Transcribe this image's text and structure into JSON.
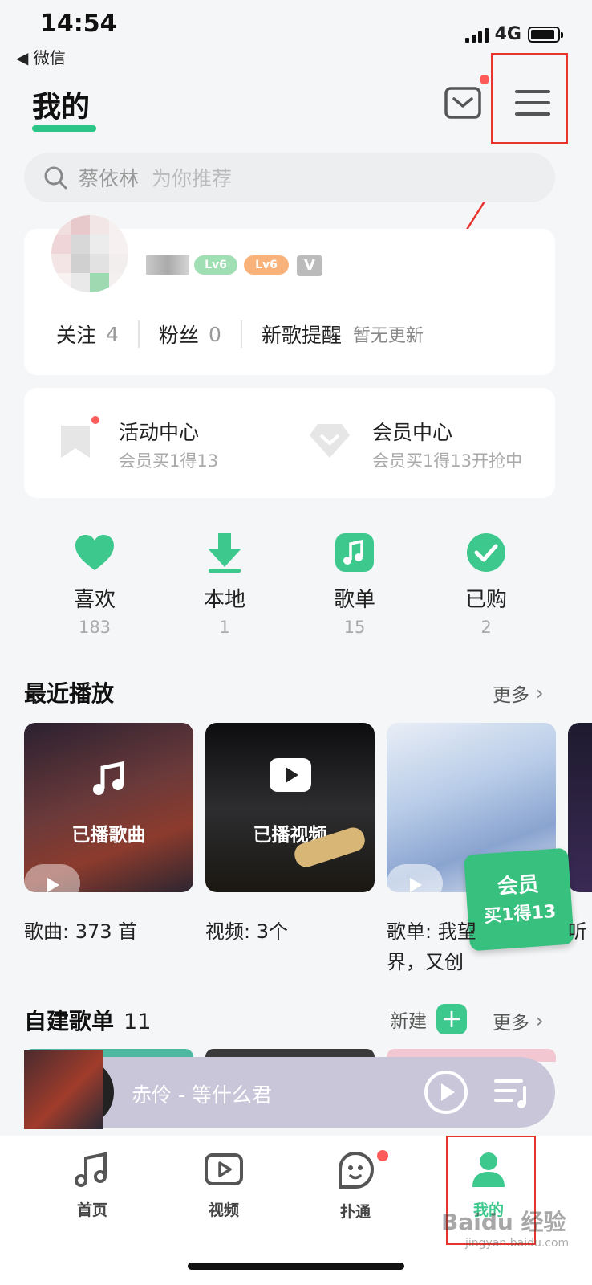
{
  "status_bar": {
    "time": "14:54",
    "back_app": "◀ 微信",
    "network": "4G"
  },
  "header": {
    "title": "我的"
  },
  "search": {
    "placeholder": "蔡依林",
    "hint": "为你推荐"
  },
  "profile": {
    "badges": [
      "Lv6",
      "Lv6",
      "V"
    ],
    "stats": [
      {
        "label": "关注",
        "value": "4"
      },
      {
        "label": "粉丝",
        "value": "0"
      }
    ],
    "new_song_label": "新歌提醒",
    "new_song_status": "暂无更新"
  },
  "activity": {
    "items": [
      {
        "title": "活动中心",
        "subtitle": "会员买1得13"
      },
      {
        "title": "会员中心",
        "subtitle": "会员买1得13开抢中"
      }
    ]
  },
  "quick_links": [
    {
      "label": "喜欢",
      "count": "183",
      "icon": "heart-icon"
    },
    {
      "label": "本地",
      "count": "1",
      "icon": "download-icon"
    },
    {
      "label": "歌单",
      "count": "15",
      "icon": "music-note-icon"
    },
    {
      "label": "已购",
      "count": "2",
      "icon": "check-icon"
    }
  ],
  "recent": {
    "title": "最近播放",
    "more": "更多",
    "tiles": [
      {
        "overlay": "已播歌曲",
        "caption": "歌曲: 373 首"
      },
      {
        "overlay": "已播视频",
        "caption": "视频: 3个"
      },
      {
        "overlay": "",
        "caption": "歌单: 我望",
        "caption2": "界，又创"
      },
      {
        "overlay": "",
        "caption": "听"
      }
    ],
    "promo": {
      "line1": "会员",
      "line2": "买1得13"
    }
  },
  "playlists": {
    "title": "自建歌单",
    "count": "11",
    "new_label": "新建",
    "more": "更多"
  },
  "player": {
    "song": "赤伶 - 等什么君"
  },
  "bottom_nav": [
    {
      "label": "首页",
      "icon": "music-note-icon"
    },
    {
      "label": "视频",
      "icon": "video-play-icon"
    },
    {
      "label": "扑通",
      "icon": "bubble-face-icon"
    },
    {
      "label": "我的",
      "icon": "user-icon"
    }
  ],
  "watermark": {
    "text": "Baidu 经验",
    "url": "jingyan.baidu.com"
  },
  "colors": {
    "accent": "#2dc587",
    "annotation": "#e8342e",
    "badge_dot": "#ff5a5a"
  }
}
